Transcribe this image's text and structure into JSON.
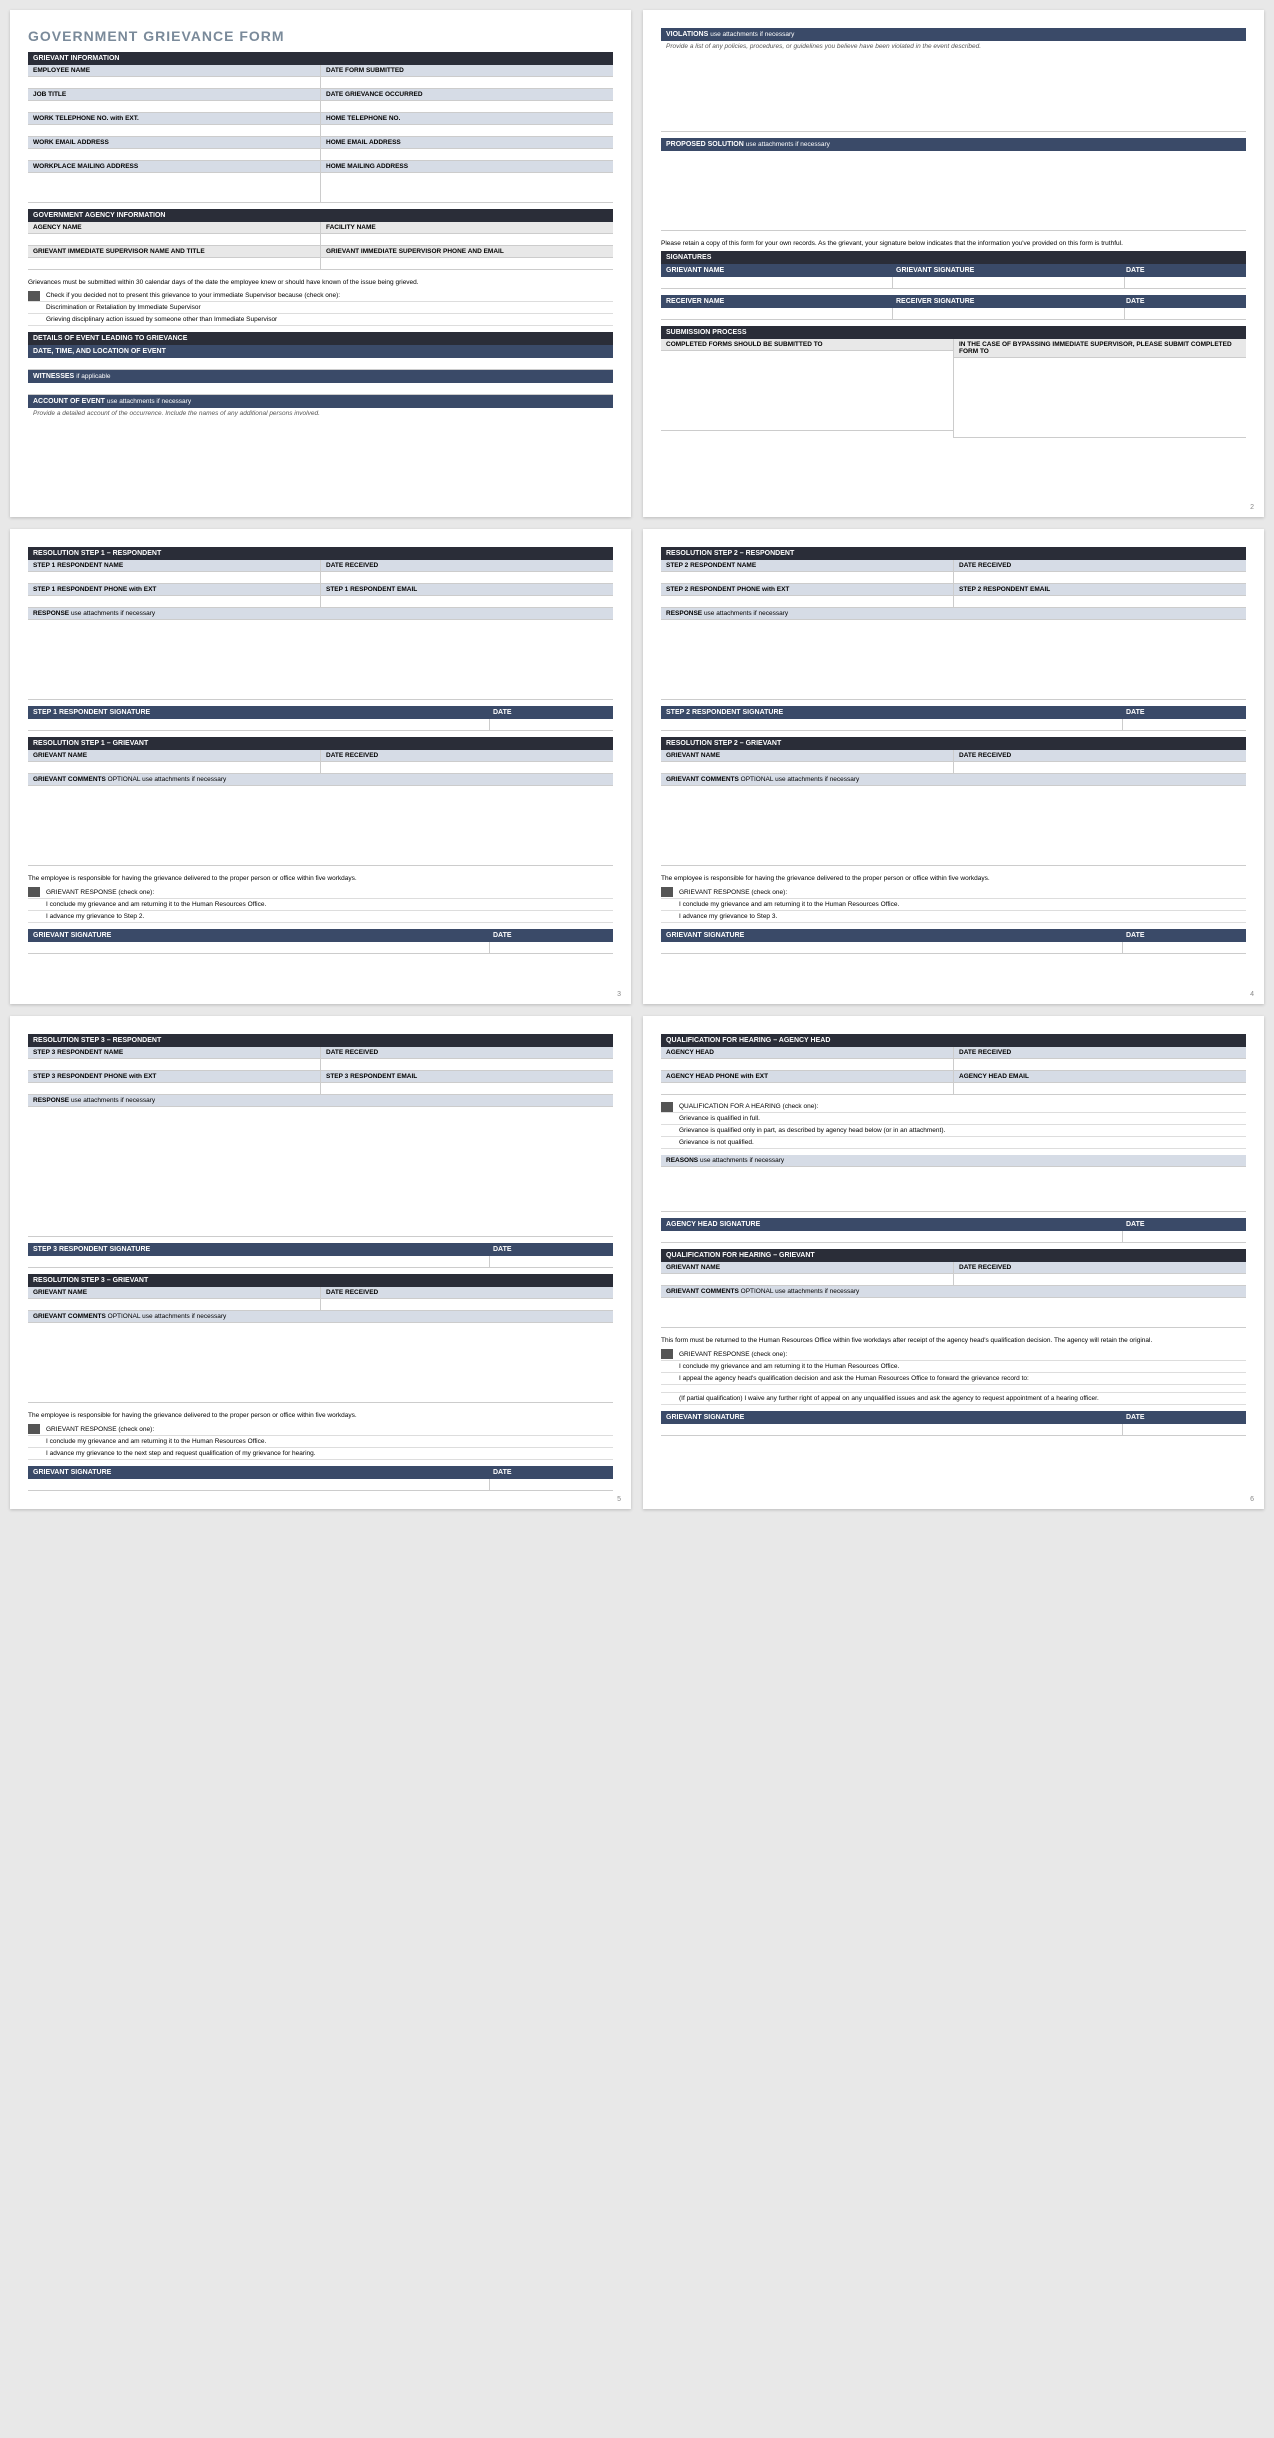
{
  "title": "GOVERNMENT GRIEVANCE FORM",
  "p1": {
    "s1": "GRIEVANT INFORMATION",
    "f1": "EMPLOYEE NAME",
    "f2": "DATE FORM SUBMITTED",
    "f3": "JOB TITLE",
    "f4": "DATE GRIEVANCE OCCURRED",
    "f5": "WORK TELEPHONE NO. with EXT.",
    "f6": "HOME TELEPHONE NO.",
    "f7": "WORK EMAIL ADDRESS",
    "f8": "HOME EMAIL ADDRESS",
    "f9": "WORKPLACE MAILING ADDRESS",
    "f10": "HOME MAILING ADDRESS",
    "s2": "GOVERNMENT AGENCY INFORMATION",
    "f11": "AGENCY NAME",
    "f12": "FACILITY NAME",
    "f13": "GRIEVANT IMMEDIATE SUPERVISOR NAME AND TITLE",
    "f14": "GRIEVANT IMMEDIATE SUPERVISOR PHONE AND EMAIL",
    "n1": "Grievances must be submitted within 30 calendar days of the date the employee knew or should have known of the issue being grieved.",
    "c1": "Check if you decided not to present this grievance to your immediate Supervisor because (check one):",
    "c2": "Discrimination or Retaliation by Immediate Supervisor",
    "c3": "Grieving disciplinary action issued by someone other than Immediate Supervisor",
    "s3": "DETAILS OF EVENT LEADING TO GRIEVANCE",
    "s3a": "DATE, TIME, AND LOCATION OF EVENT",
    "s3b": "WITNESSES",
    "s3bs": "if applicable",
    "s3c": "ACCOUNT OF EVENT",
    "s3cs": "use attachments if necessary",
    "n2": "Provide a detailed account of the occurrence.  Include the names of any additional persons involved."
  },
  "p2": {
    "s1": "VIOLATIONS",
    "s1s": "use attachments if necessary",
    "n1": "Provide a list of any policies, procedures, or guidelines you believe have been violated in the event described.",
    "s2": "PROPOSED SOLUTION",
    "s2s": "use attachments if necessary",
    "n2": "Please retain a copy of this form for your own records.  As the grievant, your signature below indicates that the information you've provided on this form is truthful.",
    "s3": "SIGNATURES",
    "g1": "GRIEVANT NAME",
    "g2": "GRIEVANT SIGNATURE",
    "g3": "DATE",
    "r1": "RECEIVER NAME",
    "r2": "RECEIVER SIGNATURE",
    "r3": "DATE",
    "s4": "SUBMISSION PROCESS",
    "sp1": "COMPLETED FORMS SHOULD BE SUBMITTED TO",
    "sp2": "IN THE CASE OF BYPASSING IMMEDIATE SUPERVISOR, PLEASE SUBMIT COMPLETED FORM TO",
    "pn": "2"
  },
  "p3": {
    "s1": "RESOLUTION STEP 1  –  RESPONDENT",
    "f1": "STEP 1 RESPONDENT NAME",
    "f2": "DATE RECEIVED",
    "f3": "STEP 1 RESPONDENT PHONE with EXT",
    "f4": "STEP 1 RESPONDENT EMAIL",
    "r": "RESPONSE",
    "rs": "use attachments if necessary",
    "sig1": "STEP 1 RESPONDENT SIGNATURE",
    "date": "DATE",
    "s2": "RESOLUTION STEP 1  –  GRIEVANT",
    "g1": "GRIEVANT NAME",
    "g2": "DATE RECEIVED",
    "gc": "GRIEVANT COMMENTS",
    "gcs": "OPTIONAL  use attachments if necessary",
    "n1": "The employee is responsible for having the grievance delivered to the proper person or office within five workdays.",
    "c1": "GRIEVANT RESPONSE (check one):",
    "c2": "I conclude my grievance and am returning it to the Human Resources Office.",
    "c3": "I advance my grievance to Step 2.",
    "gsig": "GRIEVANT SIGNATURE",
    "pn": "3"
  },
  "p4": {
    "s1": "RESOLUTION STEP 2  –  RESPONDENT",
    "f1": "STEP 2 RESPONDENT NAME",
    "f2": "DATE RECEIVED",
    "f3": "STEP 2 RESPONDENT PHONE with EXT",
    "f4": "STEP 2 RESPONDENT EMAIL",
    "r": "RESPONSE",
    "rs": "use attachments if necessary",
    "sig1": "STEP 2 RESPONDENT SIGNATURE",
    "date": "DATE",
    "s2": "RESOLUTION STEP 2  –  GRIEVANT",
    "g1": "GRIEVANT NAME",
    "g2": "DATE RECEIVED",
    "gc": "GRIEVANT COMMENTS",
    "gcs": "OPTIONAL  use attachments if necessary",
    "n1": "The employee is responsible for having the grievance delivered to the proper person or office within five workdays.",
    "c1": "GRIEVANT RESPONSE (check one):",
    "c2": "I conclude my grievance and am returning it to the Human Resources Office.",
    "c3": "I advance my grievance to Step 3.",
    "gsig": "GRIEVANT SIGNATURE",
    "pn": "4"
  },
  "p5": {
    "s1": "RESOLUTION STEP 3  –  RESPONDENT",
    "f1": "STEP 3 RESPONDENT NAME",
    "f2": "DATE RECEIVED",
    "f3": "STEP 3 RESPONDENT PHONE with EXT",
    "f4": "STEP 3 RESPONDENT EMAIL",
    "r": "RESPONSE",
    "rs": "use attachments if necessary",
    "sig1": "STEP 3 RESPONDENT SIGNATURE",
    "date": "DATE",
    "s2": "RESOLUTION STEP 3  –  GRIEVANT",
    "g1": "GRIEVANT NAME",
    "g2": "DATE RECEIVED",
    "gc": "GRIEVANT COMMENTS",
    "gcs": "OPTIONAL  use attachments if necessary",
    "n1": "The employee is responsible for having the grievance delivered to the proper person or office within five workdays.",
    "c1": "GRIEVANT RESPONSE (check one):",
    "c2": "I conclude my grievance and am returning it to the Human Resources Office.",
    "c3": "I advance my grievance to the next step and request qualification of my grievance for hearing.",
    "gsig": "GRIEVANT SIGNATURE",
    "pn": "5"
  },
  "p6": {
    "s1": "QUALIFICATION FOR HEARING  –  AGENCY HEAD",
    "f1": "AGENCY HEAD",
    "f2": "DATE RECEIVED",
    "f3": "AGENCY HEAD PHONE with EXT",
    "f4": "AGENCY HEAD EMAIL",
    "c1": "QUALIFICATION FOR A HEARING (check one):",
    "c2": "Grievance is qualified in full.",
    "c3": "Grievance is qualified only in part, as described by agency head below (or in an attachment).",
    "c4": "Grievance is not qualified.",
    "r": "REASONS",
    "rs": "use attachments if necessary",
    "sig1": "AGENCY HEAD SIGNATURE",
    "date": "DATE",
    "s2": "QUALIFICATION FOR HEARING  –  GRIEVANT",
    "g1": "GRIEVANT NAME",
    "g2": "DATE RECEIVED",
    "gc": "GRIEVANT COMMENTS",
    "gcs": "OPTIONAL  use attachments if necessary",
    "n1": "This form must be returned to the Human Resources Office within five workdays after receipt of the agency head's qualification decision. The agency will retain the original.",
    "gc1": "GRIEVANT RESPONSE (check one):",
    "gc2": "I conclude my grievance and am returning it to the Human Resources Office.",
    "gc3": "I appeal the agency head's qualification decision and ask the Human Resources Office to forward the grievance record to:",
    "gc4": "(If partial qualification) I waive any further right of appeal on any unqualified issues and ask the agency to request appointment of a hearing officer.",
    "gsig": "GRIEVANT SIGNATURE",
    "pn": "6"
  }
}
